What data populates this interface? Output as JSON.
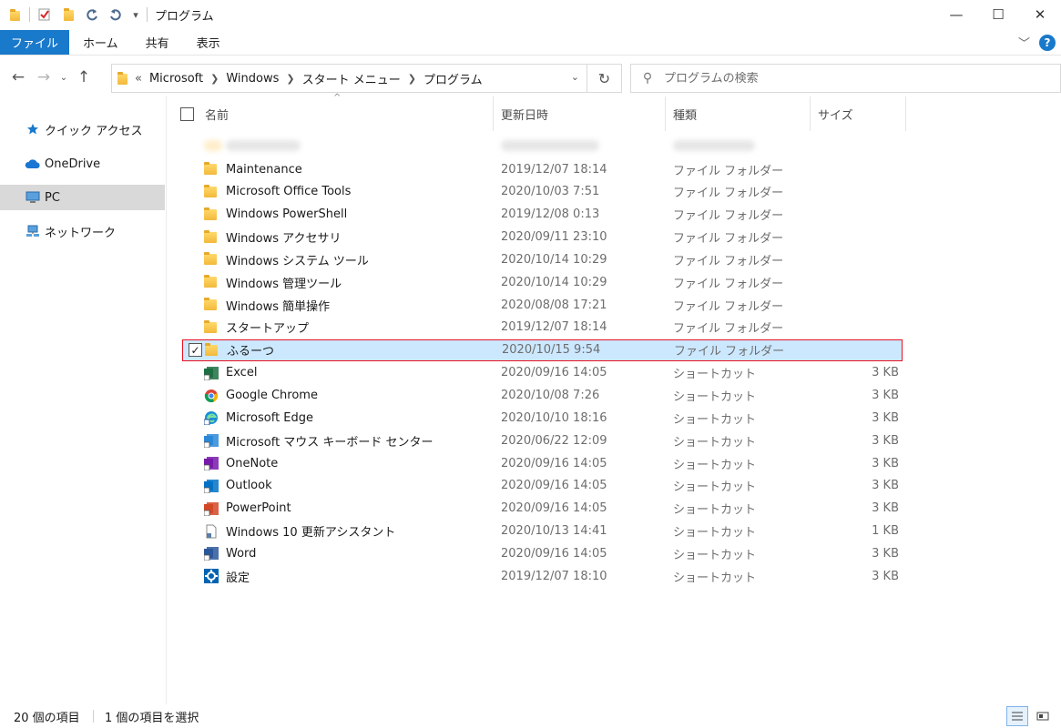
{
  "window": {
    "title": "プログラム",
    "minimize": "—",
    "maximize": "☐",
    "close": "✕"
  },
  "quick_access": {
    "dropdown": "▾"
  },
  "ribbon": {
    "tabs": [
      {
        "label": "ファイル"
      },
      {
        "label": "ホーム"
      },
      {
        "label": "共有"
      },
      {
        "label": "表示"
      }
    ],
    "expand": "﹀",
    "help": "?"
  },
  "nav": {
    "back": "←",
    "forward": "→",
    "recent": "⌄",
    "up": "↑",
    "overflow": "«",
    "breadcrumb": [
      "Microsoft",
      "Windows",
      "スタート メニュー",
      "プログラム"
    ],
    "refresh": "↻",
    "address_dropdown": "⌄"
  },
  "search": {
    "placeholder": "プログラムの検索"
  },
  "sidebar": {
    "items": [
      {
        "label": "クイック アクセス",
        "icon": "star-icon",
        "color": "#1979ca"
      },
      {
        "label": "OneDrive",
        "icon": "cloud-icon",
        "color": "#1976d2"
      },
      {
        "label": "PC",
        "icon": "computer-icon",
        "color": "#3a86c8"
      },
      {
        "label": "ネットワーク",
        "icon": "network-icon",
        "color": "#3a86c8"
      }
    ]
  },
  "columns": {
    "name": "名前",
    "date": "更新日時",
    "type": "種類",
    "size": "サイズ",
    "sort_indicator": "^"
  },
  "files": [
    {
      "name": "Maintenance",
      "date": "2019/12/07 18:14",
      "type": "ファイル フォルダー",
      "size": "",
      "icon": "folder-icon"
    },
    {
      "name": "Microsoft Office Tools",
      "date": "2020/10/03 7:51",
      "type": "ファイル フォルダー",
      "size": "",
      "icon": "folder-icon"
    },
    {
      "name": "Windows PowerShell",
      "date": "2019/12/08 0:13",
      "type": "ファイル フォルダー",
      "size": "",
      "icon": "folder-icon"
    },
    {
      "name": "Windows アクセサリ",
      "date": "2020/09/11 23:10",
      "type": "ファイル フォルダー",
      "size": "",
      "icon": "folder-icon"
    },
    {
      "name": "Windows システム ツール",
      "date": "2020/10/14 10:29",
      "type": "ファイル フォルダー",
      "size": "",
      "icon": "folder-icon"
    },
    {
      "name": "Windows 管理ツール",
      "date": "2020/10/14 10:29",
      "type": "ファイル フォルダー",
      "size": "",
      "icon": "folder-icon"
    },
    {
      "name": "Windows 簡単操作",
      "date": "2020/08/08 17:21",
      "type": "ファイル フォルダー",
      "size": "",
      "icon": "folder-icon"
    },
    {
      "name": "スタートアップ",
      "date": "2019/12/07 18:14",
      "type": "ファイル フォルダー",
      "size": "",
      "icon": "folder-icon"
    },
    {
      "name": "ふるーつ",
      "date": "2020/10/15 9:54",
      "type": "ファイル フォルダー",
      "size": "",
      "icon": "folder-icon",
      "selected": true
    },
    {
      "name": "Excel",
      "date": "2020/09/16 14:05",
      "type": "ショートカット",
      "size": "3 KB",
      "icon": "excel-icon",
      "color": "#1d6f42"
    },
    {
      "name": "Google Chrome",
      "date": "2020/10/08 7:26",
      "type": "ショートカット",
      "size": "3 KB",
      "icon": "chrome-icon",
      "color": "#db4437"
    },
    {
      "name": "Microsoft Edge",
      "date": "2020/10/10 18:16",
      "type": "ショートカット",
      "size": "3 KB",
      "icon": "edge-icon",
      "color": "#1a8fd6"
    },
    {
      "name": "Microsoft マウス キーボード センター",
      "date": "2020/06/22 12:09",
      "type": "ショートカット",
      "size": "3 KB",
      "icon": "mouse-keyboard-icon",
      "color": "#2b88d8"
    },
    {
      "name": "OneNote",
      "date": "2020/09/16 14:05",
      "type": "ショートカット",
      "size": "3 KB",
      "icon": "onenote-icon",
      "color": "#7719aa"
    },
    {
      "name": "Outlook",
      "date": "2020/09/16 14:05",
      "type": "ショートカット",
      "size": "3 KB",
      "icon": "outlook-icon",
      "color": "#0072c6"
    },
    {
      "name": "PowerPoint",
      "date": "2020/09/16 14:05",
      "type": "ショートカット",
      "size": "3 KB",
      "icon": "powerpoint-icon",
      "color": "#d24726"
    },
    {
      "name": "Windows 10 更新アシスタント",
      "date": "2020/10/13 14:41",
      "type": "ショートカット",
      "size": "1 KB",
      "icon": "file-shortcut-icon",
      "color": "#5a7ea8"
    },
    {
      "name": "Word",
      "date": "2020/09/16 14:05",
      "type": "ショートカット",
      "size": "3 KB",
      "icon": "word-icon",
      "color": "#2b579a"
    },
    {
      "name": "設定",
      "date": "2019/12/07 18:10",
      "type": "ショートカット",
      "size": "3 KB",
      "icon": "settings-icon",
      "color": "#0063b1"
    }
  ],
  "status": {
    "item_count": "20 個の項目",
    "selected_count": "1 個の項目を選択"
  },
  "colors": {
    "accent": "#1979ca",
    "selection": "#cce8ff",
    "highlight_border": "#e81123"
  }
}
